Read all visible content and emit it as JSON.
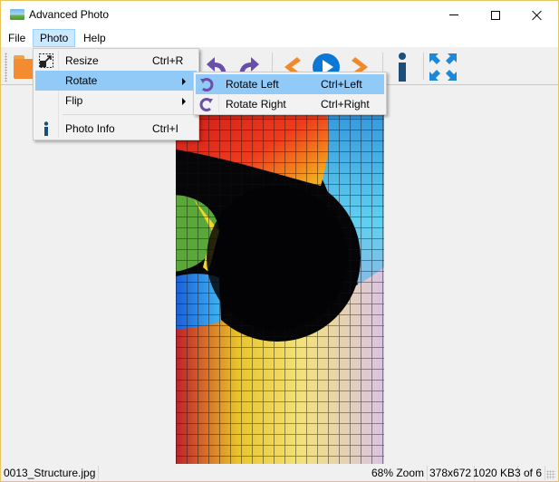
{
  "window": {
    "title": "Advanced Photo",
    "controls": {
      "minimize": "minimize",
      "maximize": "maximize",
      "close": "close"
    },
    "border_color": "#e8c55a"
  },
  "menubar": {
    "items": [
      {
        "label": "File"
      },
      {
        "label": "Photo",
        "active": true
      },
      {
        "label": "Help"
      }
    ]
  },
  "toolbar": {
    "buttons": [
      {
        "icon": "folder-icon",
        "tooltip": "Open"
      },
      {
        "icon": "undo-arrow-icon",
        "tooltip": "Rotate Left"
      },
      {
        "icon": "redo-arrow-icon",
        "tooltip": "Rotate Right"
      },
      {
        "icon": "previous-arrow-icon",
        "tooltip": "Previous"
      },
      {
        "icon": "play-icon",
        "tooltip": "Slideshow"
      },
      {
        "icon": "next-arrow-icon",
        "tooltip": "Next"
      },
      {
        "icon": "info-icon",
        "tooltip": "Photo Info"
      },
      {
        "icon": "fullscreen-icon",
        "tooltip": "Full Screen"
      }
    ]
  },
  "photo_menu": {
    "items": [
      {
        "label": "Resize",
        "accel": "Ctrl+R",
        "icon": "resize-icon"
      },
      {
        "label": "Rotate",
        "accel": "",
        "submenu": true,
        "highlighted": true
      },
      {
        "label": "Flip",
        "accel": "",
        "submenu": true
      },
      {
        "label": "Photo Info",
        "accel": "Ctrl+I",
        "icon": "info-icon"
      }
    ]
  },
  "rotate_submenu": {
    "items": [
      {
        "label": "Rotate Left",
        "accel": "Ctrl+Left",
        "icon": "rotate-left-icon",
        "highlighted": true
      },
      {
        "label": "Rotate Right",
        "accel": "Ctrl+Right",
        "icon": "rotate-right-icon"
      }
    ]
  },
  "image": {
    "description": "stained glass dome ceiling, vertical photo"
  },
  "statusbar": {
    "filename": "0013_Structure.jpg",
    "zoom": "68% Zoom",
    "dimensions": "378x672",
    "file_size": "1020 KB",
    "position": "3 of 6"
  },
  "colors": {
    "menu_highlight": "#91c9f7",
    "menubar_active": "#cce8ff",
    "icon_purple": "#6a4fa8",
    "icon_orange": "#f08a2c",
    "icon_blue": "#0a78d4",
    "icon_navy": "#1b4f7a"
  }
}
